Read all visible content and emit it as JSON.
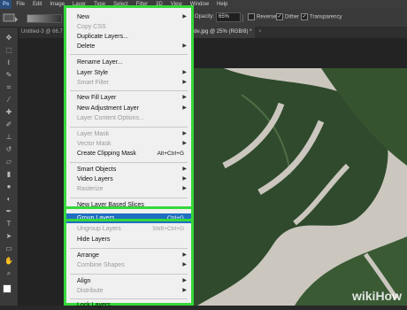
{
  "menubar": {
    "logo": "Ps",
    "items": [
      "File",
      "Edit",
      "Image",
      "Layer",
      "Type",
      "Select",
      "Filter",
      "3D",
      "View",
      "Window",
      "Help"
    ]
  },
  "options": {
    "opacity_label": "Opacity:",
    "opacity_value": "65%",
    "reverse_label": "Reverse",
    "dither_label": "Dither",
    "transparency_label": "Transparency",
    "reverse_checked": false,
    "dither_checked": true,
    "transparency_checked": true
  },
  "tabs": [
    "Untitled-3 @ 66.7",
    "de.jpg @ 25% (RGB/8) *"
  ],
  "menu": {
    "items": [
      {
        "label": "New",
        "shortcut": "",
        "submenu": true,
        "disabled": false
      },
      {
        "label": "Copy CSS",
        "shortcut": "",
        "submenu": false,
        "disabled": true
      },
      {
        "label": "Duplicate Layers...",
        "shortcut": "",
        "submenu": false,
        "disabled": false
      },
      {
        "label": "Delete",
        "shortcut": "",
        "submenu": true,
        "disabled": false
      },
      {
        "label": "Rename Layer...",
        "shortcut": "",
        "submenu": false,
        "disabled": false
      },
      {
        "label": "Layer Style",
        "shortcut": "",
        "submenu": true,
        "disabled": false
      },
      {
        "label": "Smart Filter",
        "shortcut": "",
        "submenu": true,
        "disabled": true
      },
      {
        "label": "New Fill Layer",
        "shortcut": "",
        "submenu": true,
        "disabled": false
      },
      {
        "label": "New Adjustment Layer",
        "shortcut": "",
        "submenu": true,
        "disabled": false
      },
      {
        "label": "Layer Content Options...",
        "shortcut": "",
        "submenu": false,
        "disabled": true
      },
      {
        "label": "Layer Mask",
        "shortcut": "",
        "submenu": true,
        "disabled": true
      },
      {
        "label": "Vector Mask",
        "shortcut": "",
        "submenu": true,
        "disabled": true
      },
      {
        "label": "Create Clipping Mask",
        "shortcut": "Alt+Ctrl+G",
        "submenu": false,
        "disabled": false
      },
      {
        "label": "Smart Objects",
        "shortcut": "",
        "submenu": true,
        "disabled": false
      },
      {
        "label": "Video Layers",
        "shortcut": "",
        "submenu": true,
        "disabled": false
      },
      {
        "label": "Rasterize",
        "shortcut": "",
        "submenu": true,
        "disabled": true
      },
      {
        "label": "New Layer Based Slices",
        "shortcut": "",
        "submenu": false,
        "disabled": false
      },
      {
        "label": "Group Layers",
        "shortcut": "Ctrl+G",
        "submenu": false,
        "disabled": false,
        "highlighted": true
      },
      {
        "label": "Ungroup Layers",
        "shortcut": "Shift+Ctrl+G",
        "submenu": false,
        "disabled": true
      },
      {
        "label": "Hide Layers",
        "shortcut": "",
        "submenu": false,
        "disabled": false
      },
      {
        "label": "Arrange",
        "shortcut": "",
        "submenu": true,
        "disabled": false
      },
      {
        "label": "Combine Shapes",
        "shortcut": "",
        "submenu": true,
        "disabled": true
      },
      {
        "label": "Align",
        "shortcut": "",
        "submenu": true,
        "disabled": false
      },
      {
        "label": "Distribute",
        "shortcut": "",
        "submenu": true,
        "disabled": true
      },
      {
        "label": "Lock Layers...",
        "shortcut": "",
        "submenu": false,
        "disabled": false
      }
    ]
  },
  "watermark": "wikiHow",
  "colors": {
    "highlight": "#1f6fc0",
    "annotation": "#35d83a",
    "leaf": "#2f4a2c"
  }
}
